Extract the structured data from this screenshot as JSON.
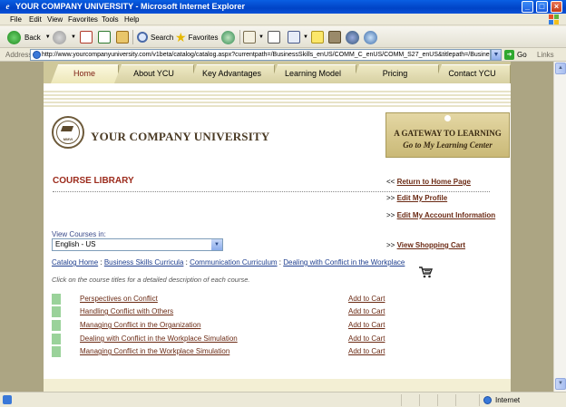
{
  "window": {
    "title": "YOUR COMPANY UNIVERSITY - Microsoft Internet Explorer",
    "buttons": {
      "minimize": "_",
      "maximize": "□",
      "close": "×"
    }
  },
  "menu": [
    "File",
    "Edit",
    "View",
    "Favorites",
    "Tools",
    "Help"
  ],
  "toolbar": {
    "back_label": "Back",
    "search_label": "Search",
    "favorites_label": "Favorites"
  },
  "address": {
    "label": "Address",
    "url": "http://www.yourcompanyuniversity.com/v1beta/catalog/catalog.aspx?currentpath=/BusinessSkills_enUS/COMM_C_enUS/COMM_S27_enUS&titlepath=/Business%20Skil",
    "go_label": "Go",
    "links_label": "Links"
  },
  "nav": {
    "tabs": [
      "Home",
      "About YCU",
      "Key Advantages",
      "Learning Model",
      "Pricing",
      "Contact YCU"
    ],
    "active": "Home"
  },
  "brand": {
    "company_name": "YOUR COMPANY UNIVERSITY",
    "seal_text": "MMVI",
    "gateway_line1": "A GATEWAY TO LEARNING",
    "gateway_line2": "Go to My Learning Center"
  },
  "page": {
    "heading": "COURSE LIBRARY",
    "view_courses_label": "View Courses in:",
    "language_selected": "English - US",
    "instructions": "Click on the course titles for a detailed description of each course."
  },
  "side_links": [
    {
      "prefix": "<<",
      "label": "Return to Home Page"
    },
    {
      "prefix": ">>",
      "label": "Edit My Profile"
    },
    {
      "prefix": ">>",
      "label": "Edit My Account Information"
    },
    {
      "prefix": ">>",
      "label": "View Shopping Cart"
    }
  ],
  "breadcrumb": [
    "Catalog Home",
    "Business Skills Curricula",
    "Communication Curriculum",
    "Dealing with Conflict in the Workplace"
  ],
  "courses": [
    {
      "title": "Perspectives on Conflict",
      "action": "Add to Cart"
    },
    {
      "title": "Handling Conflict with Others",
      "action": "Add to Cart"
    },
    {
      "title": "Managing Conflict in the Organization",
      "action": "Add to Cart"
    },
    {
      "title": "Dealing with Conflict in the Workplace Simulation",
      "action": "Add to Cart"
    },
    {
      "title": "Managing Conflict in the Workplace Simulation",
      "action": "Add to Cart"
    }
  ],
  "status": {
    "zone": "Internet"
  },
  "colors": {
    "accent": "#9c2b1c",
    "link": "#6b2a14",
    "page_frame": "#aca583",
    "course_marker": "#9ad29a"
  }
}
